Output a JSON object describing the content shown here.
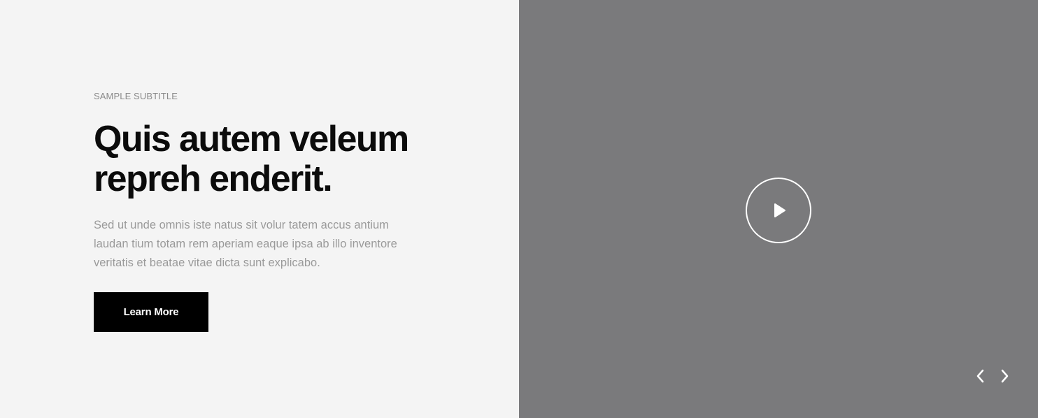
{
  "hero": {
    "subtitle": "SAMPLE SUBTITLE",
    "headline": "Quis autem veleum repreh enderit.",
    "description": "Sed ut unde omnis iste natus sit volur tatem accus antium laudan tium totam rem aperiam eaque ipsa ab illo inventore veritatis et beatae vitae dicta sunt explicabo.",
    "button_label": "Learn More"
  },
  "media": {
    "play_icon": "play-icon",
    "prev_icon": "chevron-left-icon",
    "next_icon": "chevron-right-icon"
  },
  "colors": {
    "left_background": "#f4f4f4",
    "right_background": "#7a7a7c",
    "headline": "#0b0b0b",
    "body_text": "#9a9a9a",
    "button_background": "#000000",
    "button_text": "#ffffff",
    "icon": "#ffffff"
  }
}
